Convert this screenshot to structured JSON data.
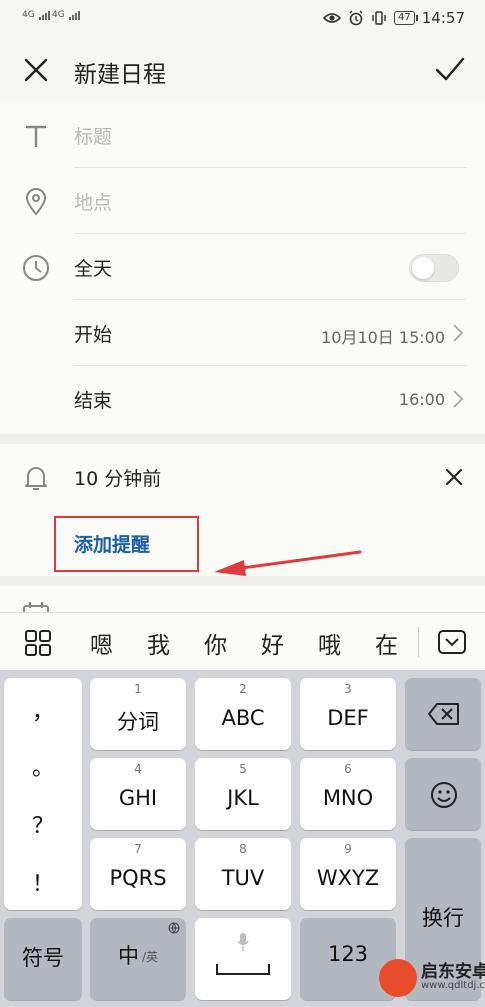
{
  "status_bar": {
    "signal_1": "4G",
    "signal_2": "4G",
    "battery": "47",
    "time": "14:57"
  },
  "header": {
    "title": "新建日程"
  },
  "form": {
    "title_placeholder": "标题",
    "location_placeholder": "地点",
    "all_day_label": "全天",
    "all_day_on": false,
    "start_label": "开始",
    "start_value": "10月10日 15:00",
    "end_label": "结束",
    "end_value": "16:00",
    "reminder_value": "10 分钟前",
    "add_reminder_label": "添加提醒"
  },
  "candidates": [
    "嗯",
    "我",
    "你",
    "好",
    "哦",
    "在"
  ],
  "keyboard": {
    "punctuation": [
      "，",
      "。",
      "？",
      "！"
    ],
    "keys": [
      {
        "num": "1",
        "label": "分词"
      },
      {
        "num": "2",
        "label": "ABC"
      },
      {
        "num": "3",
        "label": "DEF"
      },
      {
        "num": "4",
        "label": "GHI"
      },
      {
        "num": "5",
        "label": "JKL"
      },
      {
        "num": "6",
        "label": "MNO"
      },
      {
        "num": "7",
        "label": "PQRS"
      },
      {
        "num": "8",
        "label": "TUV"
      },
      {
        "num": "9",
        "label": "WXYZ"
      }
    ],
    "symbols_label": "符号",
    "lang_label": "中",
    "lang_sub": "/英",
    "num_label": "123",
    "enter_label": "换行"
  },
  "watermark": {
    "name": "启东安卓网",
    "url": "www.qdltdj.com"
  },
  "colors": {
    "accent_blue": "#1a5fa8",
    "annotation_red": "#e23a3a"
  }
}
